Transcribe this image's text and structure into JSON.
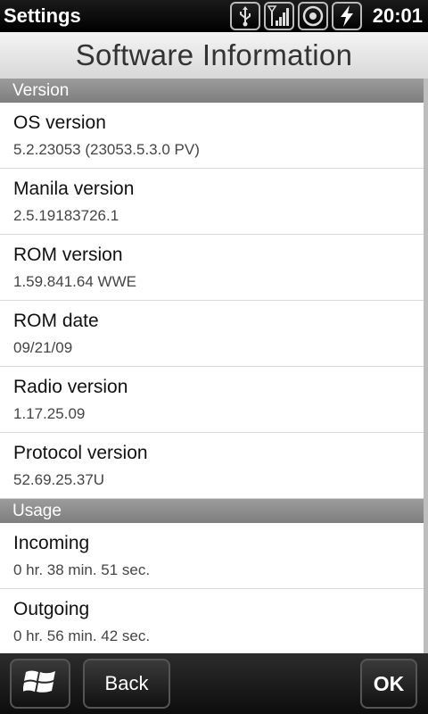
{
  "statusbar": {
    "title": "Settings",
    "time": "20:01",
    "icons": [
      "usb-icon",
      "signal-icon",
      "disc-icon",
      "charging-icon"
    ]
  },
  "header": {
    "title": "Software Information"
  },
  "sections": [
    {
      "label": "Version",
      "items": [
        {
          "label": "OS version",
          "value": "5.2.23053 (23053.5.3.0 PV)"
        },
        {
          "label": "Manila version",
          "value": "2.5.19183726.1"
        },
        {
          "label": "ROM version",
          "value": "1.59.841.64 WWE"
        },
        {
          "label": "ROM date",
          "value": "09/21/09"
        },
        {
          "label": "Radio version",
          "value": "1.17.25.09"
        },
        {
          "label": "Protocol version",
          "value": "52.69.25.37U"
        }
      ]
    },
    {
      "label": "Usage",
      "items": [
        {
          "label": "Incoming",
          "value": "0 hr. 38 min. 51 sec."
        },
        {
          "label": "Outgoing",
          "value": "0 hr. 56 min. 42 sec."
        }
      ]
    }
  ],
  "bottombar": {
    "start_icon": "windows-icon",
    "back_label": "Back",
    "ok_label": "OK"
  },
  "colors": {
    "section_bg": "#8e8e8e",
    "banner_bg": "#e6e6e6",
    "bar_bg": "#1e1e1e"
  }
}
